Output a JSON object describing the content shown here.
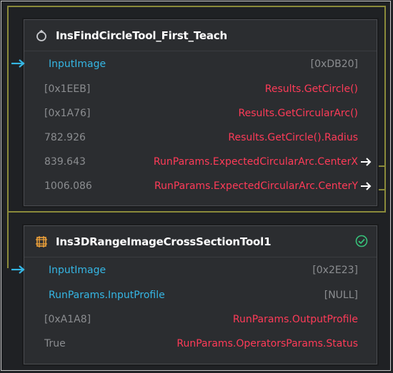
{
  "colors": {
    "background": "#1f2124",
    "node_bg": "#2b2d30",
    "title": "#ffffff",
    "cyan": "#35b6e4",
    "red": "#ff3b58",
    "gray": "#8b8d90",
    "status_green": "#37c27a",
    "link": "#8a8a3a"
  },
  "node1": {
    "icon": "circle-find-icon",
    "title": "InsFindCircleTool_First_Teach",
    "rows": [
      {
        "left": "InputImage",
        "right": "[0xDB20]"
      },
      {
        "left": "[0x1EEB]",
        "right": "Results.GetCircle()"
      },
      {
        "left": "[0x1A76]",
        "right": "Results.GetCircularArc()"
      },
      {
        "left": "782.926",
        "right": "Results.GetCircle().Radius"
      },
      {
        "left": "839.643",
        "right": "RunParams.ExpectedCircularArc.CenterX"
      },
      {
        "left": "1006.086",
        "right": "RunParams.ExpectedCircularArc.CenterY"
      }
    ]
  },
  "node2": {
    "icon": "cross-section-icon",
    "title": "Ins3DRangeImageCrossSectionTool1",
    "status_icon": "check-circle-icon",
    "rows": [
      {
        "left": "InputImage",
        "right": "[0x2E23]"
      },
      {
        "left": "RunParams.InputProfile",
        "right": "[NULL]"
      },
      {
        "left": "[0xA1A8]",
        "right": "RunParams.OutputProfile"
      },
      {
        "left": "True",
        "right": "RunParams.OperatorsParams.Status"
      }
    ]
  }
}
